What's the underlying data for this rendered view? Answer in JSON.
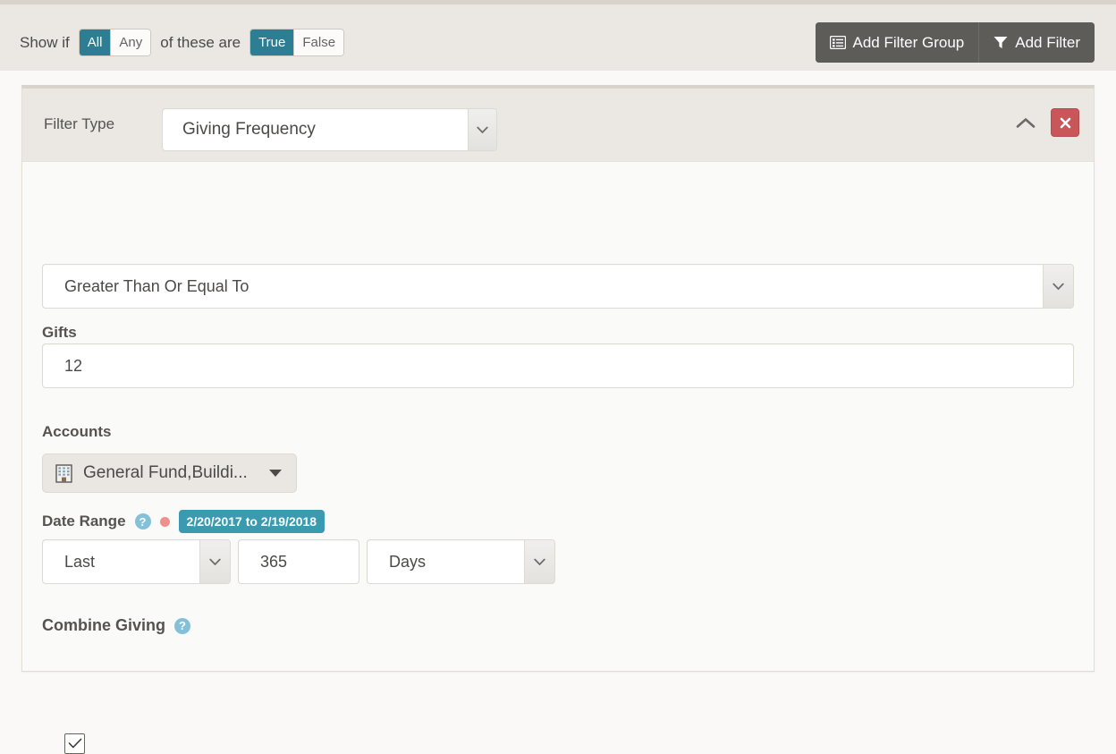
{
  "toolbar": {
    "show_if_label": "Show if",
    "of_these_are_label": "of these are",
    "match_options": [
      {
        "label": "All",
        "active": true
      },
      {
        "label": "Any",
        "active": false
      }
    ],
    "truth_options": [
      {
        "label": "True",
        "active": true
      },
      {
        "label": "False",
        "active": false
      }
    ],
    "add_filter_group_label": "Add Filter Group",
    "add_filter_group_icon": "list-alt-icon",
    "add_filter_label": "Add Filter",
    "add_filter_icon": "funnel-icon"
  },
  "panel": {
    "filter_type_label": "Filter Type",
    "filter_type_value": "Giving Frequency",
    "collapse_icon": "chevron-up-icon",
    "delete_icon": "close-x-icon",
    "comparison_value": "Greater Than Or Equal To",
    "gifts_label": "Gifts",
    "gifts_value": "12",
    "accounts_label": "Accounts",
    "accounts_value": "General Fund,Buildi...",
    "accounts_icon": "building-icon",
    "date_range_label": "Date Range",
    "date_range_help_icon": "help-circle-icon",
    "date_range_indicator": "required-dot-icon",
    "date_range_badge": "2/20/2017 to 2/19/2018",
    "date_mode_value": "Last",
    "date_amount_value": "365",
    "date_unit_value": "Days",
    "combine_giving_label": "Combine Giving",
    "combine_giving_help_icon": "help-circle-icon",
    "combine_giving_checked": true,
    "check_icon": "checkmark-icon"
  },
  "colors": {
    "accent_teal": "#2d7e92",
    "badge_teal": "#3a9bb0",
    "danger_red": "#c9575a",
    "dark_button": "#5e5c59",
    "panel_header": "#ebe8e4",
    "panel_body": "#fafaf8",
    "help_blue": "#84c1d8",
    "indicator_pink": "#f0908c"
  }
}
